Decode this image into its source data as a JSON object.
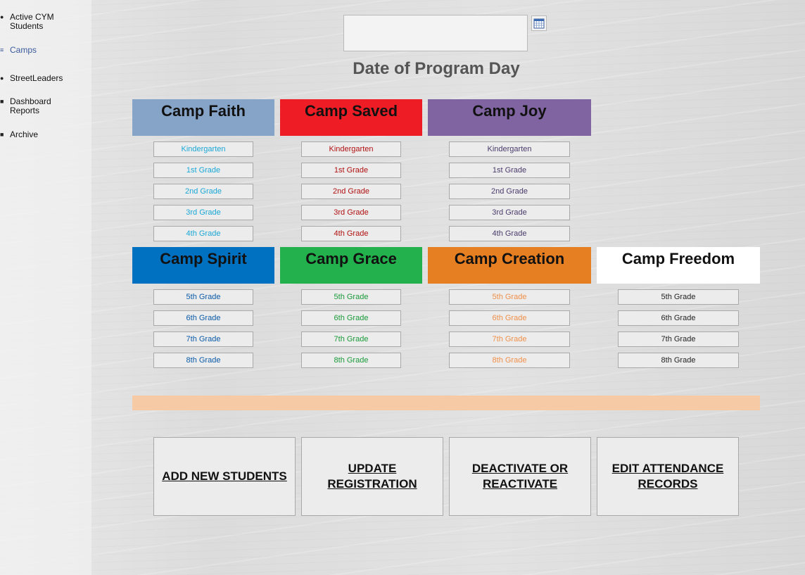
{
  "sidebar": {
    "items": [
      {
        "label": "Active CYM Students",
        "icon": "user-icon"
      },
      {
        "label": "Camps",
        "icon": "camps-icon"
      },
      {
        "label": "StreetLeaders",
        "icon": "user-icon"
      },
      {
        "label": "Dashboard Reports",
        "icon": "chart-icon"
      },
      {
        "label": "Archive",
        "icon": "archive-icon"
      }
    ],
    "active_color": "#3a5a9a"
  },
  "date": {
    "value": "",
    "title": "Date of Program Day",
    "calendar_icon": "calendar-icon"
  },
  "camps_row1": [
    {
      "name": "Camp Faith",
      "color": "#86a3c8",
      "text_color": "#1aa7d6",
      "grades": [
        "Kindergarten",
        "1st Grade",
        "2nd Grade",
        "3rd Grade",
        "4th Grade"
      ]
    },
    {
      "name": "Camp Saved",
      "color": "#ee1c25",
      "text_color": "#b01010",
      "grades": [
        "Kindergarten",
        "1st Grade",
        "2nd Grade",
        "3rd Grade",
        "4th Grade"
      ]
    },
    {
      "name": "Camp Joy",
      "color": "#8064a2",
      "text_color": "#4a3a6a",
      "grades": [
        "Kindergarten",
        "1st Grade",
        "2nd Grade",
        "3rd Grade",
        "4th Grade"
      ]
    }
  ],
  "camps_row2": [
    {
      "name": "Camp Spirit",
      "color": "#0070c0",
      "text_color": "#0a5aa8",
      "grades": [
        "5th Grade",
        "6th Grade",
        "7th Grade",
        "8th Grade"
      ]
    },
    {
      "name": "Camp Grace",
      "color": "#22b14c",
      "text_color": "#1a9a3a",
      "grades": [
        "5th Grade",
        "6th Grade",
        "7th Grade",
        "8th Grade"
      ]
    },
    {
      "name": "Camp Creation",
      "color": "#e67e22",
      "text_color": "#f0904a",
      "grades": [
        "5th Grade",
        "6th Grade",
        "7th Grade",
        "8th Grade"
      ]
    },
    {
      "name": "Camp Freedom",
      "color": "#ffffff",
      "text_color": "#222222",
      "grades": [
        "5th Grade",
        "6th Grade",
        "7th Grade",
        "8th Grade"
      ]
    }
  ],
  "divider_color": "#f5caa5",
  "actions": [
    {
      "label": "ADD NEW STUDENTS"
    },
    {
      "label": "UPDATE REGISTRATION"
    },
    {
      "label": "DEACTIVATE OR REACTIVATE"
    },
    {
      "label": "EDIT ATTENDANCE RECORDS"
    }
  ]
}
